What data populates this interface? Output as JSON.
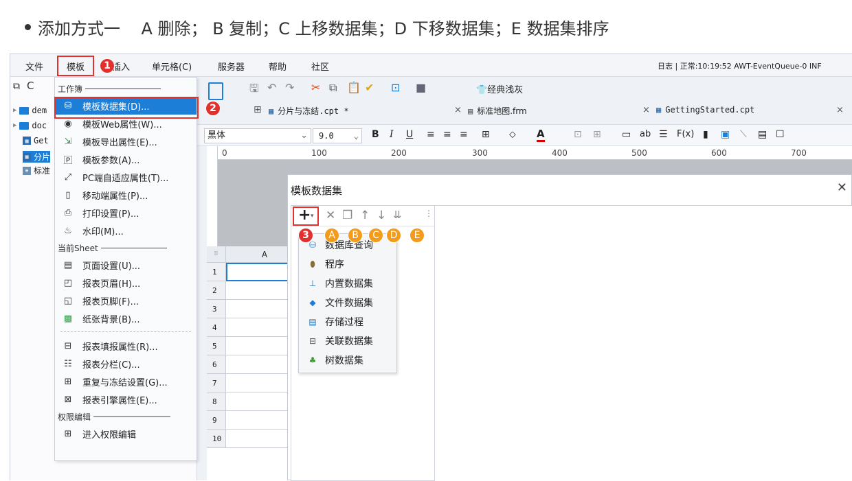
{
  "caption": {
    "text": "添加方式一    A 删除； B 复制；C 上移数据集；D 下移数据集；E 数据集排序"
  },
  "menubar": {
    "items": [
      "文件",
      "模板",
      "插入",
      "单元格(C)",
      "服务器",
      "帮助",
      "社区"
    ],
    "status": "日志 | 正常:10:19:52 AWT-EventQueue-0 INF"
  },
  "badges": [
    "1",
    "2",
    "3"
  ],
  "orange_badges": [
    "A",
    "B",
    "C",
    "D",
    "E"
  ],
  "tree": {
    "items": [
      "dem",
      "doc",
      "Get",
      "分片",
      "标准"
    ]
  },
  "template_menu": {
    "group_workbook": "工作簿",
    "items_workbook": [
      {
        "label": "模板数据集(D)...",
        "icon": "database-icon"
      },
      {
        "label": "模板Web属性(W)...",
        "icon": "globe-icon"
      },
      {
        "label": "模板导出属性(E)...",
        "icon": "export-icon"
      },
      {
        "label": "模板参数(A)...",
        "icon": "parameter-icon"
      },
      {
        "label": "PC端自适应属性(T)...",
        "icon": "resize-icon"
      },
      {
        "label": "移动端属性(P)...",
        "icon": "mobile-icon"
      },
      {
        "label": "打印设置(P)...",
        "icon": "printer-icon"
      },
      {
        "label": "水印(M)...",
        "icon": "watermark-icon"
      }
    ],
    "group_sheet": "当前Sheet",
    "items_sheet": [
      {
        "label": "页面设置(U)...",
        "icon": "page-setup-icon"
      },
      {
        "label": "报表页眉(H)...",
        "icon": "header-icon"
      },
      {
        "label": "报表页脚(F)...",
        "icon": "footer-icon"
      },
      {
        "label": "纸张背景(B)...",
        "icon": "background-icon"
      },
      {
        "label": "报表填报属性(R)...",
        "icon": "fill-icon"
      },
      {
        "label": "报表分栏(C)...",
        "icon": "columns-icon"
      },
      {
        "label": "重复与冻结设置(G)...",
        "icon": "freeze-icon"
      },
      {
        "label": "报表引擎属性(E)...",
        "icon": "engine-icon"
      }
    ],
    "group_perm": "权限编辑",
    "items_perm": [
      {
        "label": "进入权限编辑",
        "icon": "permission-icon"
      }
    ]
  },
  "toolbar": {
    "theme_label": "经典浅灰"
  },
  "tabs": [
    {
      "label": "分片与冻结.cpt *"
    },
    {
      "label": "标准地图.frm"
    },
    {
      "label": "GettingStarted.cpt"
    }
  ],
  "format": {
    "font": "黑体",
    "size": "9.0"
  },
  "ruler": {
    "ticks": [
      "0",
      "100",
      "200",
      "300",
      "400",
      "500",
      "600",
      "700"
    ]
  },
  "grid": {
    "column": "A",
    "rows": [
      "1",
      "2",
      "3",
      "4",
      "5",
      "6",
      "7",
      "8",
      "9",
      "10"
    ]
  },
  "dialog": {
    "title": "模板数据集",
    "close": "✕",
    "add_symbol": "+",
    "popup_items": [
      {
        "label": "数据库查询",
        "icon": "db-query-icon",
        "color": "#3b82c4"
      },
      {
        "label": "程序",
        "icon": "program-icon",
        "color": "#8a6d3b"
      },
      {
        "label": "内置数据集",
        "icon": "builtin-dataset-icon",
        "color": "#2b6cb0"
      },
      {
        "label": "文件数据集",
        "icon": "file-dataset-icon",
        "color": "#1c7ed6"
      },
      {
        "label": "存储过程",
        "icon": "stored-proc-icon",
        "color": "#1c6fb8"
      },
      {
        "label": "关联数据集",
        "icon": "relation-dataset-icon",
        "color": "#555555"
      },
      {
        "label": "树数据集",
        "icon": "tree-dataset-icon",
        "color": "#3c9a2f"
      }
    ]
  },
  "colors": {
    "highlight_red": "#e0312f",
    "badge_orange": "#f39b1b",
    "selection_blue": "#1c7ed6"
  }
}
